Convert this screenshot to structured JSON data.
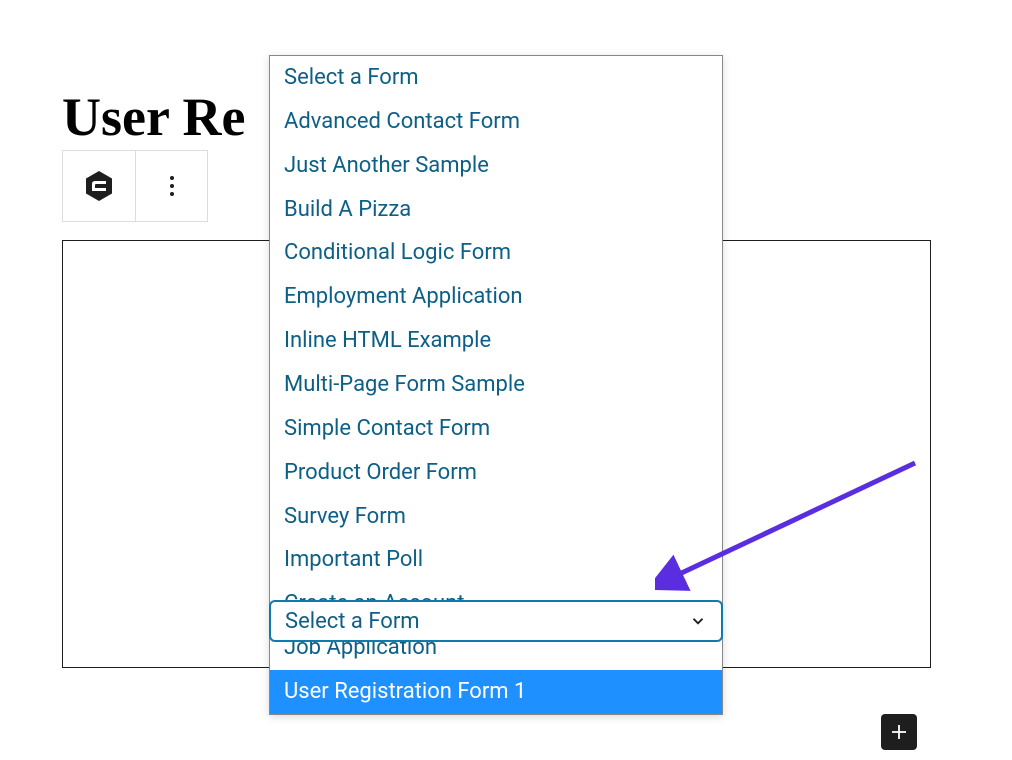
{
  "page": {
    "title": "User Re"
  },
  "dropdown": {
    "options": [
      {
        "label": "Select a Form",
        "highlighted": false
      },
      {
        "label": "Advanced Contact Form",
        "highlighted": false
      },
      {
        "label": "Just Another Sample",
        "highlighted": false
      },
      {
        "label": "Build A Pizza",
        "highlighted": false
      },
      {
        "label": "Conditional Logic Form",
        "highlighted": false
      },
      {
        "label": "Employment Application",
        "highlighted": false
      },
      {
        "label": "Inline HTML Example",
        "highlighted": false
      },
      {
        "label": "Multi-Page Form Sample",
        "highlighted": false
      },
      {
        "label": "Simple Contact Form",
        "highlighted": false
      },
      {
        "label": "Product Order Form",
        "highlighted": false
      },
      {
        "label": "Survey Form",
        "highlighted": false
      },
      {
        "label": "Important Poll",
        "highlighted": false
      },
      {
        "label": "Create an Account",
        "highlighted": false
      },
      {
        "label": "Job Application",
        "highlighted": false
      },
      {
        "label": "User Registration Form 1",
        "highlighted": true
      }
    ],
    "selected_label": "Select a Form"
  }
}
